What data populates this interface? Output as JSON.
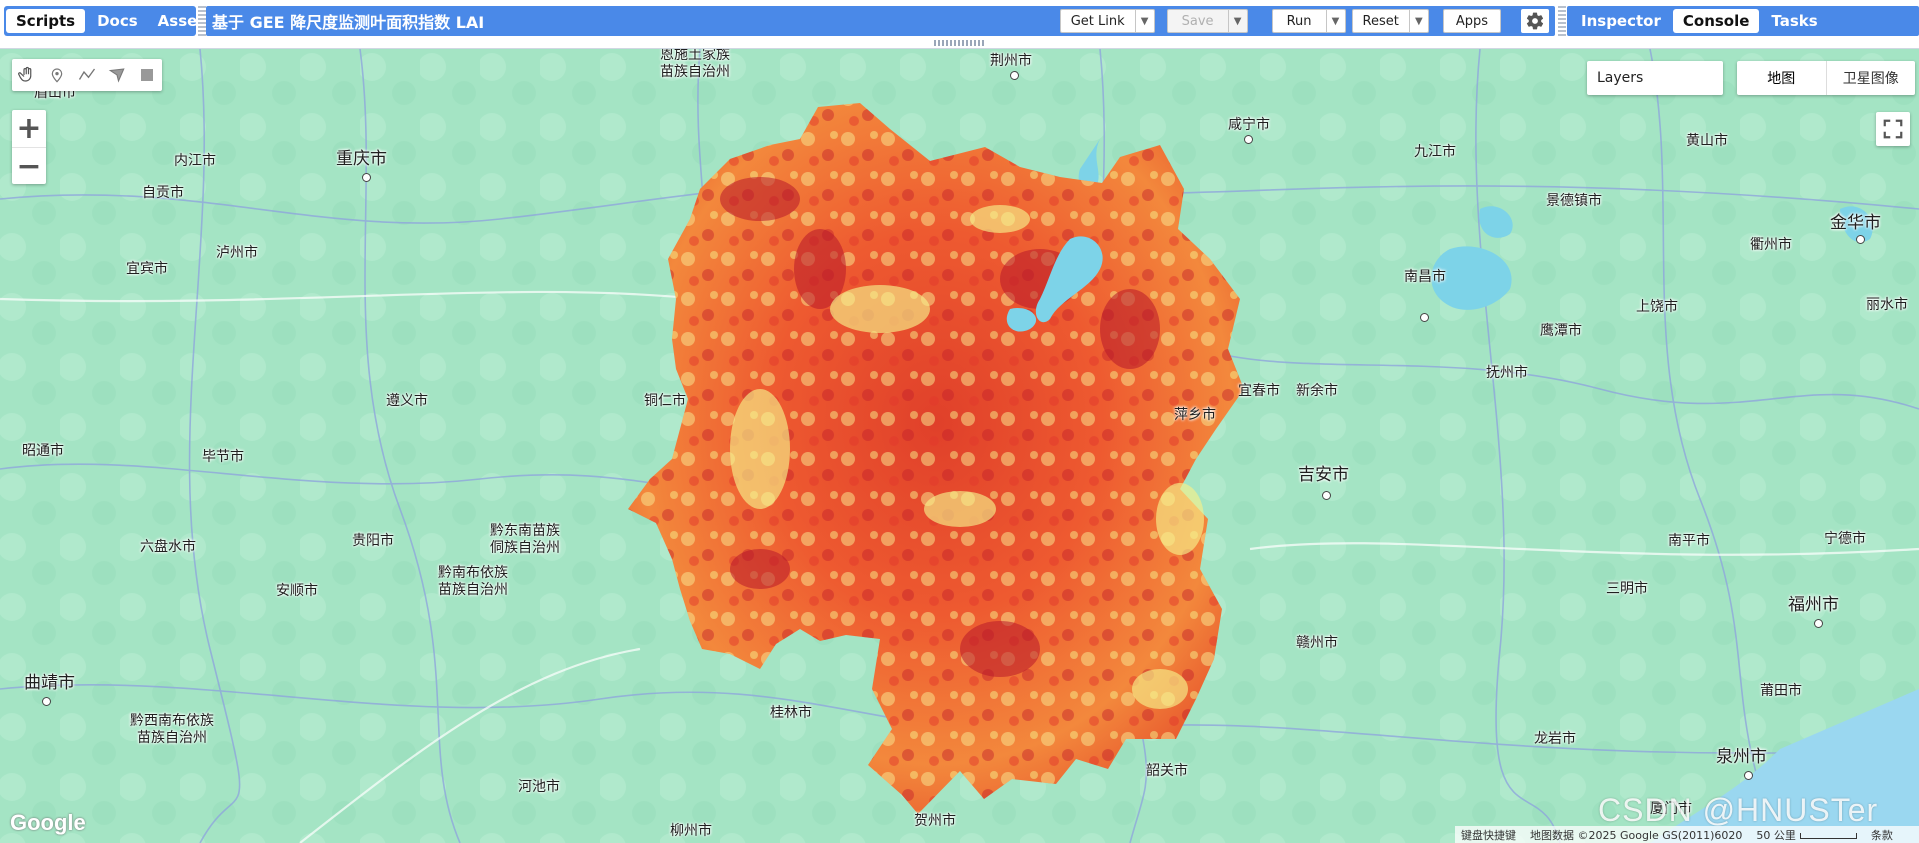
{
  "left_tabs": [
    "Scripts",
    "Docs",
    "Asse"
  ],
  "editor": {
    "title": "基于 GEE 降尺度监测叶面积指数 LAI",
    "get_link": "Get Link",
    "save": "Save",
    "run": "Run",
    "reset": "Reset",
    "apps": "Apps"
  },
  "right_tabs": [
    "Inspector",
    "Console",
    "Tasks"
  ],
  "map": {
    "layers_label": "Layers",
    "map_type": [
      "地图",
      "卫星图像"
    ],
    "zoom_in": "+",
    "zoom_out": "−",
    "google_logo": "Google",
    "attribution": [
      "键盘快捷键",
      "地图数据 ©2025 Google GS(2011)6020",
      "50 公里",
      "条款"
    ],
    "watermark": "CSDN @HNUSTer",
    "colors": {
      "base": "#a4e4c4",
      "water": "#7dd3e8",
      "roads": "#8fa6dc",
      "lai_low": "#f6f08a",
      "lai_mid": "#f0642e",
      "lai_high": "#b8182a"
    },
    "places": [
      {
        "name": "恩施土家族",
        "name2": "苗族自治州"
      },
      {
        "name": "荆州市"
      },
      {
        "name": "咸宁市"
      },
      {
        "name": "九江市"
      },
      {
        "name": "黄山市"
      },
      {
        "name": "内江市"
      },
      {
        "name": "重庆市"
      },
      {
        "name": "自贡市"
      },
      {
        "name": "景德镇市"
      },
      {
        "name": "金华市"
      },
      {
        "name": "泸州市"
      },
      {
        "name": "宜宾市"
      },
      {
        "name": "衢州市"
      },
      {
        "name": "南昌市"
      },
      {
        "name": "上饶市"
      },
      {
        "name": "丽水市"
      },
      {
        "name": "鹰潭市"
      },
      {
        "name": "抚州市"
      },
      {
        "name": "遵义市"
      },
      {
        "name": "铜仁市"
      },
      {
        "name": "宜春市"
      },
      {
        "name": "新余市"
      },
      {
        "name": "萍乡市"
      },
      {
        "name": "昭通市"
      },
      {
        "name": "毕节市"
      },
      {
        "name": "吉安市"
      },
      {
        "name": "六盘水市"
      },
      {
        "name": "贵阳市"
      },
      {
        "name": "黔东南苗族",
        "name2": "侗族自治州"
      },
      {
        "name": "黔南布依族",
        "name2": "苗族自治州"
      },
      {
        "name": "安顺市"
      },
      {
        "name": "南平市"
      },
      {
        "name": "宁德市"
      },
      {
        "name": "三明市"
      },
      {
        "name": "福州市"
      },
      {
        "name": "赣州市"
      },
      {
        "name": "曲靖市"
      },
      {
        "name": "黔西南布依族",
        "name2": "苗族自治州"
      },
      {
        "name": "桂林市"
      },
      {
        "name": "莆田市"
      },
      {
        "name": "龙岩市"
      },
      {
        "name": "泉州市"
      },
      {
        "name": "韶关市"
      },
      {
        "name": "河池市"
      },
      {
        "name": "贺州市"
      },
      {
        "name": "柳州市"
      },
      {
        "name": "厦门市"
      },
      {
        "name": "眉山市"
      }
    ]
  }
}
